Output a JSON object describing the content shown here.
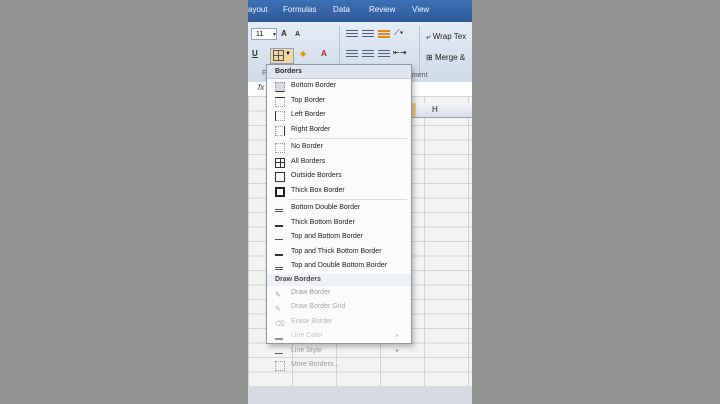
{
  "ribbon": {
    "tabs": [
      "ayout",
      "Formulas",
      "Data",
      "Review",
      "View"
    ],
    "font_size_value": "11",
    "grow_font": "A",
    "shrink_font": "A",
    "underline": "U",
    "font_color": "A",
    "wrap_text": "Wrap Tex",
    "merge": "Merge &",
    "group_font": "Fo",
    "group_alignment": "nment"
  },
  "formula_bar": {
    "fx": "fx"
  },
  "sheet": {
    "column_header": "H"
  },
  "menu": {
    "title": "Borders",
    "items_a": [
      {
        "label": "Bottom Border",
        "icon": "bottom-border-icon"
      },
      {
        "label": "Top Border",
        "icon": "top-border-icon"
      },
      {
        "label": "Left Border",
        "icon": "left-border-icon"
      },
      {
        "label": "Right Border",
        "icon": "right-border-icon"
      }
    ],
    "items_b": [
      {
        "label": "No Border",
        "icon": "no-border-icon"
      },
      {
        "label": "All Borders",
        "icon": "all-borders-icon"
      },
      {
        "label": "Outside Borders",
        "icon": "outside-borders-icon"
      },
      {
        "label": "Thick Box Border",
        "icon": "thick-box-border-icon"
      }
    ],
    "items_c": [
      {
        "label": "Bottom Double Border",
        "icon": "bottom-double-border-icon"
      },
      {
        "label": "Thick Bottom Border",
        "icon": "thick-bottom-border-icon"
      },
      {
        "label": "Top and Bottom Border",
        "icon": "top-bottom-border-icon"
      },
      {
        "label": "Top and Thick Bottom Border",
        "icon": "top-thick-bottom-border-icon"
      },
      {
        "label": "Top and Double Bottom Border",
        "icon": "top-double-bottom-border-icon"
      }
    ],
    "draw_header": "Draw Borders",
    "draw_items": [
      {
        "label": "Draw Border",
        "icon": "pencil-icon"
      },
      {
        "label": "Draw Border Grid",
        "icon": "pencil-grid-icon"
      },
      {
        "label": "Erase Border",
        "icon": "eraser-icon"
      },
      {
        "label": "Line Color",
        "icon": "line-color-icon",
        "submenu": true
      },
      {
        "label": "Line Style",
        "icon": "line-style-icon",
        "submenu": true
      },
      {
        "label": "More Borders...",
        "icon": "more-borders-icon"
      }
    ]
  },
  "colors": {
    "tab_bar": "#2c5a9c",
    "ribbon": "#dbe5f1",
    "highlight": "#f5d7a0",
    "letterbox": "#939292"
  }
}
